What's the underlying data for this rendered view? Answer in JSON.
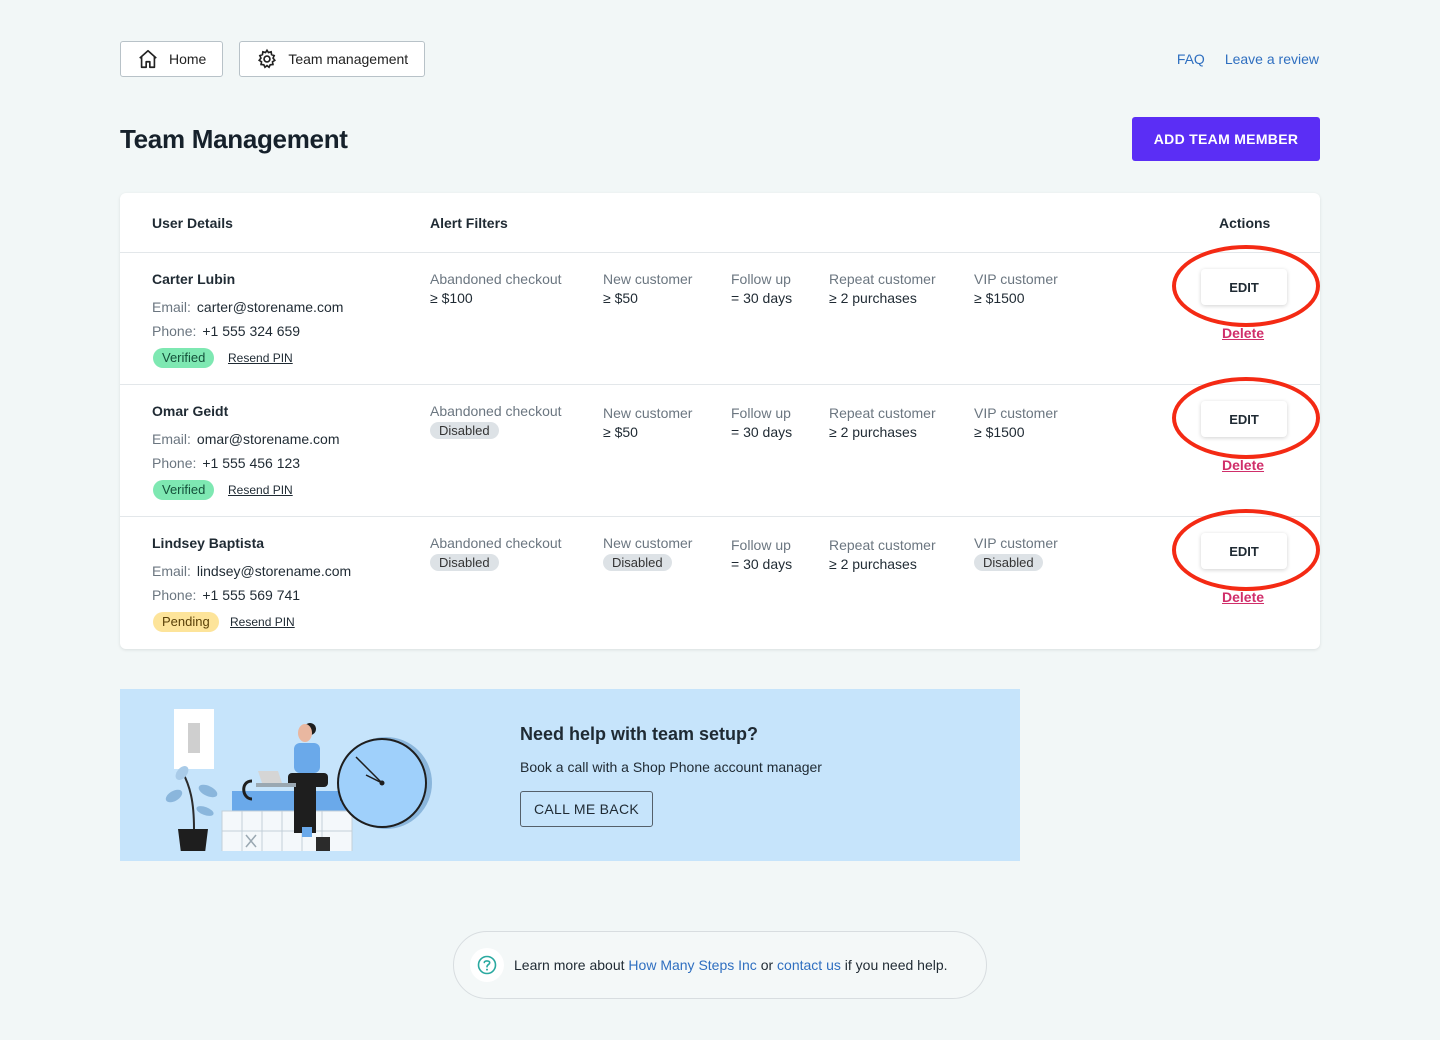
{
  "nav": {
    "home_label": "Home",
    "team_label": "Team management",
    "faq_label": "FAQ",
    "review_label": "Leave a review"
  },
  "page": {
    "title": "Team Management",
    "add_button": "ADD TEAM MEMBER"
  },
  "table": {
    "headers": {
      "user": "User Details",
      "filters": "Alert Filters",
      "actions": "Actions"
    },
    "email_label": "Email:",
    "phone_label": "Phone:",
    "resend_label": "Resend PIN",
    "edit_label": "EDIT",
    "delete_label": "Delete",
    "rows": [
      {
        "name": "Carter Lubin",
        "email": "carter@storename.com",
        "phone": "+1 555 324 659",
        "status": "Verified",
        "filters": {
          "abandoned": {
            "title": "Abandoned checkout",
            "value": "≥ $100"
          },
          "new": {
            "title": "New customer",
            "value": "≥ $50"
          },
          "follow": {
            "title": "Follow up",
            "value": "= 30 days"
          },
          "repeat": {
            "title": "Repeat customer",
            "value": "≥ 2 purchases"
          },
          "vip": {
            "title": "VIP customer",
            "value": "≥ $1500"
          }
        }
      },
      {
        "name": "Omar Geidt",
        "email": "omar@storename.com",
        "phone": "+1 555 456 123",
        "status": "Verified",
        "filters": {
          "abandoned": {
            "title": "Abandoned checkout",
            "value": "Disabled"
          },
          "new": {
            "title": "New customer",
            "value": "≥ $50"
          },
          "follow": {
            "title": "Follow up",
            "value": "= 30 days"
          },
          "repeat": {
            "title": "Repeat customer",
            "value": "≥ 2 purchases"
          },
          "vip": {
            "title": "VIP customer",
            "value": "≥ $1500"
          }
        }
      },
      {
        "name": "Lindsey Baptista",
        "email": "lindsey@storename.com",
        "phone": "+1 555 569 741",
        "status": "Pending",
        "filters": {
          "abandoned": {
            "title": "Abandoned checkout",
            "value": "Disabled"
          },
          "new": {
            "title": "New customer",
            "value": "Disabled"
          },
          "follow": {
            "title": "Follow up",
            "value": "= 30 days"
          },
          "repeat": {
            "title": "Repeat customer",
            "value": "≥ 2 purchases"
          },
          "vip": {
            "title": "VIP customer",
            "value": "Disabled"
          }
        }
      }
    ]
  },
  "help": {
    "title": "Need help with team setup?",
    "subtitle": "Book a call with a Shop Phone account manager",
    "button": "CALL ME BACK"
  },
  "footer": {
    "prefix": "Learn more about",
    "company_link": "How Many Steps Inc",
    "middle": "or",
    "contact_link": "contact us",
    "suffix": "if you need help."
  },
  "colors": {
    "accent": "#5b2ef5",
    "link": "#2f6fc0",
    "delete": "#d02e6a",
    "annotation": "#f42a14",
    "verified_badge": "#7ee8b2",
    "pending_badge": "#fde49a",
    "banner": "#c6e4fb"
  },
  "icons": [
    "home-icon",
    "gear-icon",
    "question-icon"
  ]
}
